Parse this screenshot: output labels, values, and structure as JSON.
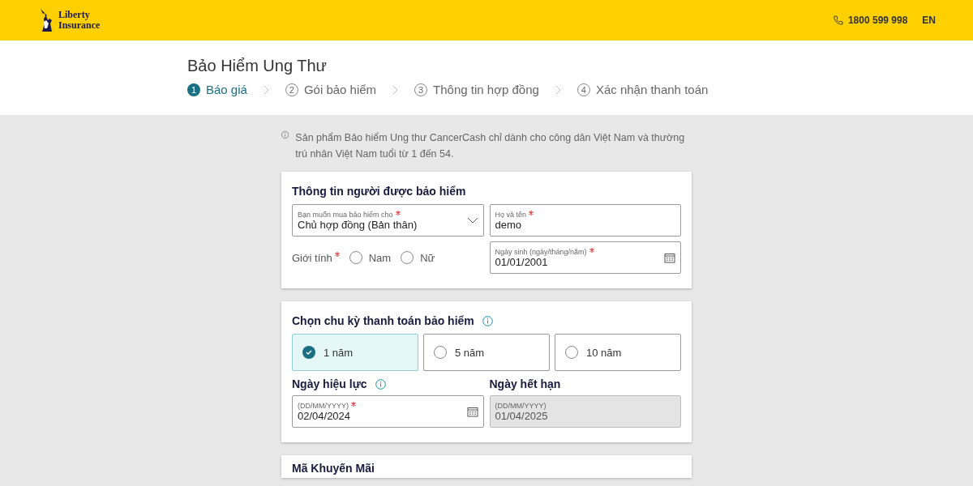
{
  "header": {
    "logo_line_1": "Liberty",
    "logo_line_2": "Insurance",
    "phone": "1800 599 998",
    "language": "EN"
  },
  "title": "Bảo Hiểm Ung Thư",
  "steps": [
    {
      "number": "1",
      "label": "Báo giá",
      "selected": true
    },
    {
      "number": "2",
      "label": "Gói bảo hiểm",
      "selected": false
    },
    {
      "number": "3",
      "label": "Thông tin hợp đồng",
      "selected": false
    },
    {
      "number": "4",
      "label": "Xác nhận thanh toán",
      "selected": false
    }
  ],
  "notice": "Sản phẩm Bảo hiểm Ung thư CancerCash chỉ dành cho công dân Việt Nam và thường trú nhân Việt Nam tuổi từ 1 đến 54.",
  "insured_card": {
    "title": "Thông tin người được bảo hiểm",
    "buy_for": {
      "label": "Bạn muốn mua bảo hiểm cho",
      "value": "Chủ hợp đồng (Bản thân)",
      "required": true
    },
    "full_name": {
      "label": "Họ và tên",
      "value": "demo",
      "required": true
    },
    "gender": {
      "label": "Giới tính",
      "required": true,
      "options": [
        {
          "label": "Nam",
          "selected": false
        },
        {
          "label": "Nữ",
          "selected": false
        }
      ]
    },
    "birth_date": {
      "label": "Ngày sinh (ngày/tháng/năm)",
      "value": "01/01/2001",
      "required": true
    }
  },
  "payment_card": {
    "title": "Chọn chu kỳ thanh toán bảo hiểm",
    "periods": [
      {
        "label": "1 năm",
        "selected": true
      },
      {
        "label": "5 năm",
        "selected": false
      },
      {
        "label": "10 năm",
        "selected": false
      }
    ],
    "effective_date": {
      "title": "Ngày hiệu lực",
      "label": "(DD/MM/YYYY)",
      "value": "02/04/2024",
      "disabled": false
    },
    "expiry_date": {
      "title": "Ngày hết hạn",
      "label": "(DD/MM/YYYY)",
      "value": "01/04/2025",
      "disabled": true
    }
  },
  "promo_card": {
    "title": "Mã Khuyến Mãi"
  }
}
